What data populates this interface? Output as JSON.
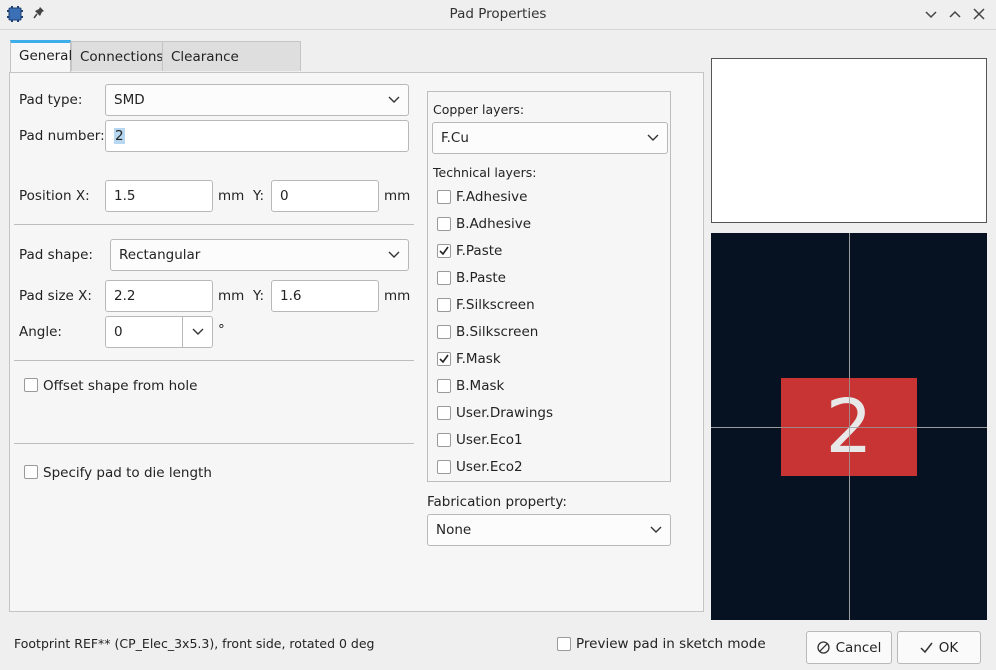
{
  "window": {
    "title": "Pad Properties",
    "icons": [
      "app-icon",
      "pin-icon",
      "minimize-icon",
      "maximize-icon",
      "close-icon"
    ]
  },
  "tabs": [
    {
      "label": "General",
      "active": true
    },
    {
      "label": "Connections",
      "active": false
    },
    {
      "label": "Clearance Overrides",
      "active": false
    }
  ],
  "general": {
    "pad_type_label": "Pad type:",
    "pad_type_value": "SMD",
    "pad_number_label": "Pad number:",
    "pad_number_value": "2",
    "position_x_label": "Position X:",
    "position_x_value": "1.5",
    "position_x_unit": "mm",
    "position_y_label": "Y:",
    "position_y_value": "0",
    "position_y_unit": "mm",
    "pad_shape_label": "Pad shape:",
    "pad_shape_value": "Rectangular",
    "size_x_label": "Pad size X:",
    "size_x_value": "2.2",
    "size_x_unit": "mm",
    "size_y_label": "Y:",
    "size_y_value": "1.6",
    "size_y_unit": "mm",
    "angle_label": "Angle:",
    "angle_value": "0",
    "angle_unit": "°",
    "offset_label": "Offset shape from hole",
    "offset_checked": false,
    "die_length_label": "Specify pad to die length",
    "die_length_checked": false
  },
  "layers": {
    "copper_label": "Copper layers:",
    "copper_value": "F.Cu",
    "technical_label": "Technical layers:",
    "technical": [
      {
        "name": "F.Adhesive",
        "checked": false
      },
      {
        "name": "B.Adhesive",
        "checked": false
      },
      {
        "name": "F.Paste",
        "checked": true
      },
      {
        "name": "B.Paste",
        "checked": false
      },
      {
        "name": "F.Silkscreen",
        "checked": false
      },
      {
        "name": "B.Silkscreen",
        "checked": false
      },
      {
        "name": "F.Mask",
        "checked": true
      },
      {
        "name": "B.Mask",
        "checked": false
      },
      {
        "name": "User.Drawings",
        "checked": false
      },
      {
        "name": "User.Eco1",
        "checked": false
      },
      {
        "name": "User.Eco2",
        "checked": false
      }
    ],
    "fabrication_label": "Fabrication property:",
    "fabrication_value": "None"
  },
  "preview": {
    "pad_label": "2",
    "pad_color": "#c83434",
    "background_color": "#061121",
    "crosshair_color": "#9a9a9a"
  },
  "footer": {
    "status": "Footprint REF** (CP_Elec_3x5.3), front side, rotated 0 deg",
    "sketch_label": "Preview pad in sketch mode",
    "sketch_checked": false,
    "cancel_label": "Cancel",
    "ok_label": "OK"
  },
  "colors": {
    "accent": "#3daee9",
    "window_bg": "#efefef"
  }
}
